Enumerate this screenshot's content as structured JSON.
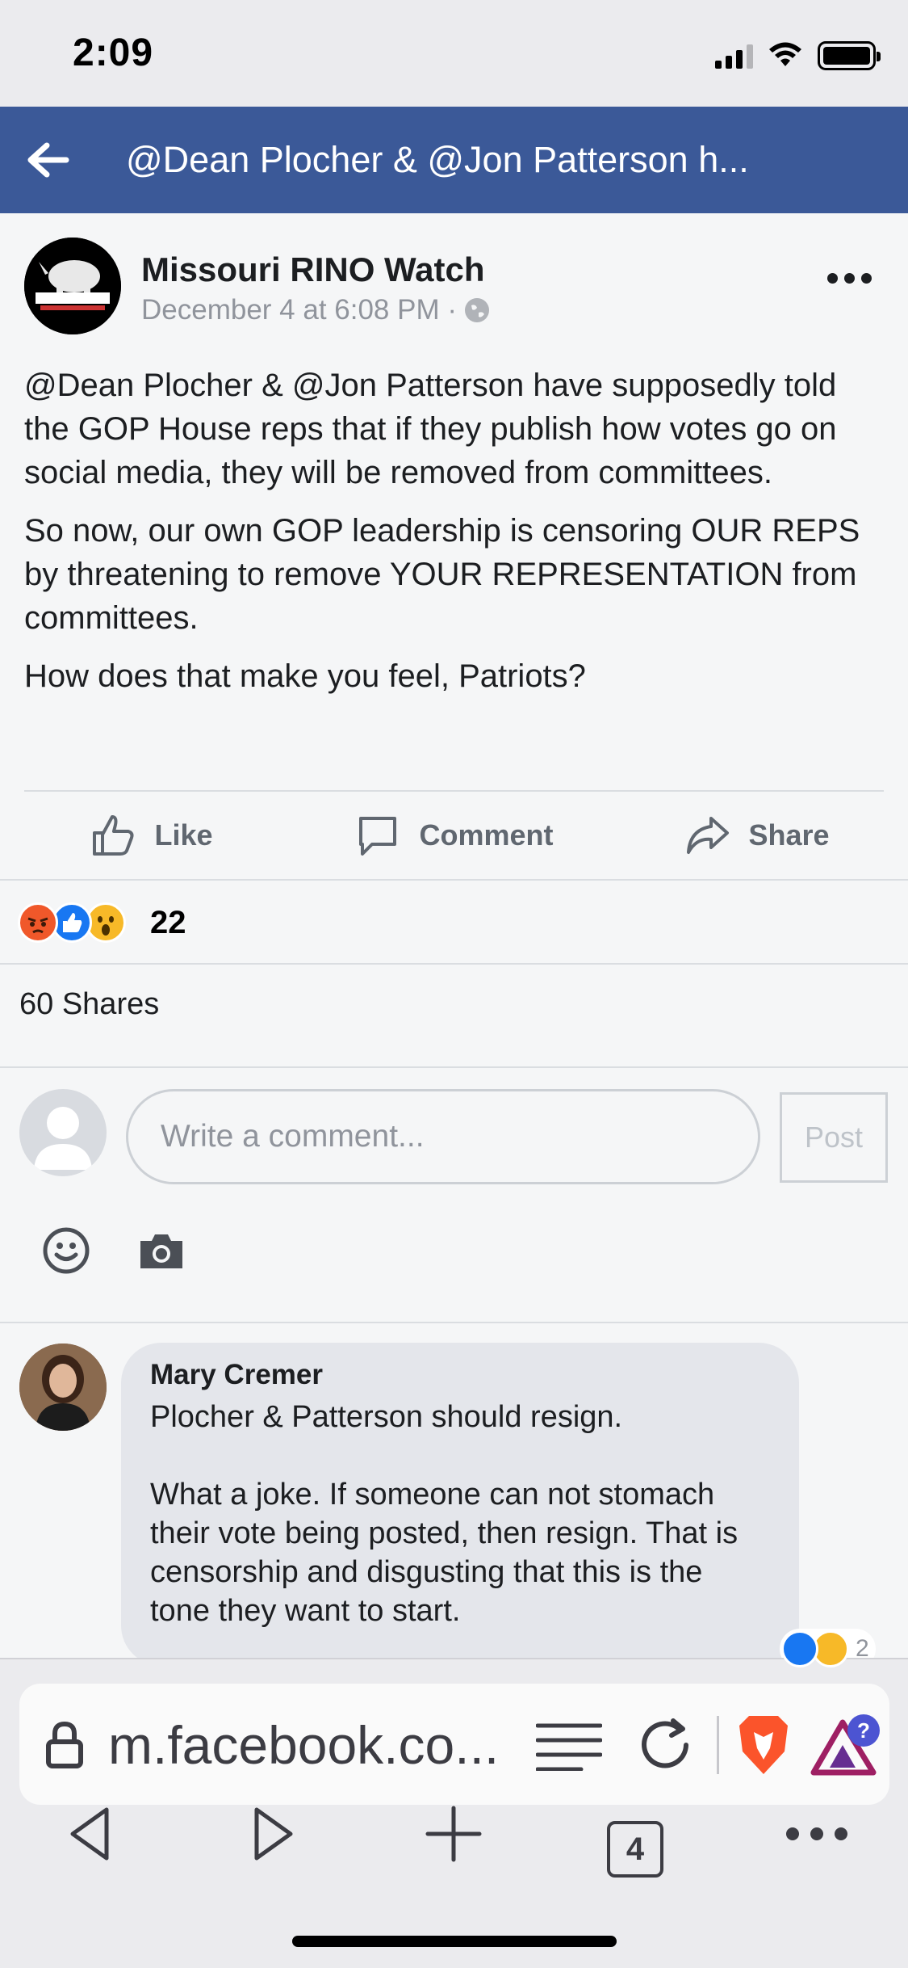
{
  "status_bar": {
    "time": "2:09"
  },
  "nav": {
    "title": "@Dean Plocher & @Jon Patterson h..."
  },
  "post": {
    "page_name": "Missouri RINO Watch",
    "timestamp": "December 4 at 6:08 PM ·",
    "paragraphs": [
      "@Dean Plocher & @Jon Patterson have supposedly told the GOP House reps that if they publish how votes go on social media, they will be removed from committees.",
      "So now, our own GOP leadership is censoring OUR REPS by threatening to remove YOUR REPRESENTATION from committees.",
      "How does that make you feel, Patriots?"
    ],
    "actions": {
      "like": "Like",
      "comment": "Comment",
      "share": "Share"
    },
    "reaction_count": "22",
    "shares": "60 Shares"
  },
  "composer": {
    "placeholder": "Write a comment...",
    "post_label": "Post"
  },
  "comment": {
    "author": "Mary Cremer",
    "text": "Plocher & Patterson should resign.\n\nWhat a joke. If someone can not stomach their vote being posted, then resign. That is censorship and disgusting that this is the tone they want to start.",
    "reaction_count": "2"
  },
  "browser": {
    "url": "m.facebook.co...",
    "tab_count": "4"
  },
  "icons": {
    "back": "arrow-left-icon",
    "more": "more-icon",
    "globe": "globe-icon",
    "like": "thumbs-up-icon",
    "comment": "comment-bubble-icon",
    "share": "share-arrow-icon",
    "emoji": "emoji-icon",
    "camera": "camera-icon",
    "lock": "lock-icon",
    "reader": "reader-mode-icon",
    "reload": "reload-icon",
    "brave": "brave-shield-icon",
    "rewards": "brave-rewards-icon",
    "nav_back": "chevron-left-icon",
    "nav_forward": "chevron-right-icon",
    "new_tab": "plus-icon",
    "tabs": "tabs-icon",
    "menu": "ellipsis-icon"
  },
  "colors": {
    "header": "#3b5998",
    "angry": "#f0582a",
    "like": "#1877f2",
    "wow": "#f7b928"
  }
}
